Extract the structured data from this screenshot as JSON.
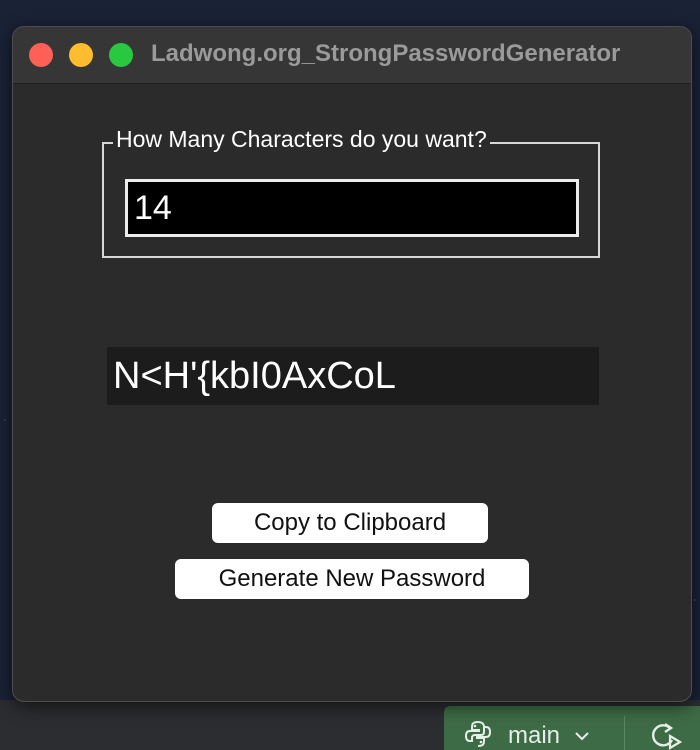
{
  "window": {
    "title": "Ladwong.org_StrongPasswordGenerator"
  },
  "length_group": {
    "label": "How Many Characters do you want?",
    "value": "14"
  },
  "password": {
    "value": "N<H'{kbI0AxCoL"
  },
  "buttons": {
    "copy_label": "Copy to Clipboard",
    "generate_label": "Generate New Password"
  },
  "ide_status": {
    "branch": "main",
    "icons": [
      "python-icon",
      "chevron-down-icon",
      "rerun-icon"
    ]
  },
  "colors": {
    "window_bg": "#2b2b2b",
    "titlebar_bg": "#363636",
    "close": "#fe5f57",
    "minimize": "#febc2e",
    "zoom": "#28c840",
    "git_widget": "#3d6b45"
  }
}
